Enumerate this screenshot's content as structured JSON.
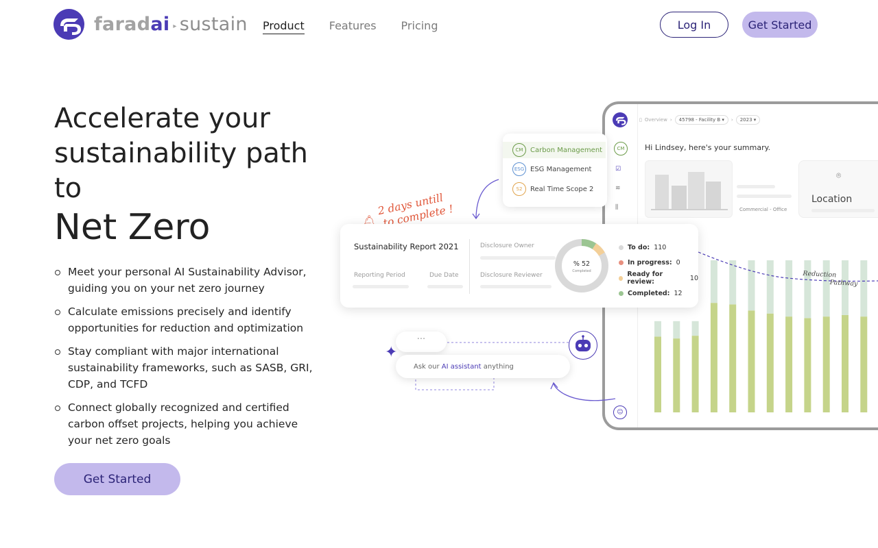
{
  "brand": {
    "name_part1": "farad",
    "name_part2": "ai",
    "separator": "▸",
    "product": "sustain",
    "accent": "#4b3bb5",
    "button_fill": "#c3b9ec"
  },
  "nav": {
    "links": [
      {
        "label": "Product",
        "active": true
      },
      {
        "label": "Features",
        "active": false
      },
      {
        "label": "Pricing",
        "active": false
      }
    ],
    "login_label": "Log In",
    "get_started_label": "Get Started"
  },
  "hero": {
    "title": "Accelerate your sustainability path to",
    "title_emphasis": "Net Zero",
    "bullets": [
      "Meet your personal AI Sustainability Advisor, guiding you on your net zero journey",
      "Calculate emissions precisely and identify opportunities for reduction and optimization",
      "Stay compliant with major international sustainability frameworks, such as SASB, GRI, CDP, and TCFD",
      "Connect globally recognized and certified carbon offset projects, helping you achieve your net zero goals"
    ],
    "cta_label": "Get Started"
  },
  "illustration": {
    "breadcrumb": {
      "root": "Overview",
      "facility": "45798 - Facility B",
      "year": "2023"
    },
    "greeting": "Hi Lindsey, here's your summary.",
    "location_label": "Location",
    "building_type": "Commercial - Office",
    "sidebar_badge": "CM",
    "menu": [
      {
        "badge": "CM",
        "label": "Carbon Management",
        "color": "#6a9a47"
      },
      {
        "badge": "ESG",
        "label": "ESG Management",
        "color": "#5b8fd1"
      },
      {
        "badge": "S2",
        "label": "Real Time Scope 2",
        "color": "#e0a34a"
      }
    ],
    "reminder": {
      "line1": "2 days untill",
      "line2": "to complete !"
    },
    "report": {
      "title": "Sustainability Report 2021",
      "reporting_period_label": "Reporting Period",
      "due_date_label": "Due Date",
      "disclosure_owner_label": "Disclosure Owner",
      "disclosure_reviewer_label": "Disclosure Reviewer",
      "donut_value": "% 52",
      "donut_caption": "Completed",
      "status": [
        {
          "label": "To do:",
          "value": "110",
          "color": "#d9d9d9"
        },
        {
          "label": "In progress:",
          "value": "0",
          "color": "#e8907f"
        },
        {
          "label": "Ready for review:",
          "value": "10",
          "color": "#f3cf98"
        },
        {
          "label": "Completed:",
          "value": "12",
          "color": "#9bc592"
        }
      ]
    },
    "reduction_label_1": "Reduction",
    "reduction_label_2": "Pathway",
    "ai": {
      "dots": "···",
      "ask_prefix": "Ask our ",
      "ask_highlight": "AI assistant",
      "ask_suffix": " anything"
    }
  },
  "chart_data": {
    "type": "bar",
    "stacked": true,
    "bars": 12,
    "series": [
      {
        "values": [
          0.83,
          0.81,
          0.84,
          0.72,
          0.71,
          0.67,
          0.65,
          0.63,
          0.62,
          0.63,
          0.64,
          0.63
        ],
        "color": "#c5d48a"
      },
      {
        "values": [
          0.17,
          0.19,
          0.16,
          0.28,
          0.29,
          0.33,
          0.35,
          0.37,
          0.38,
          0.37,
          0.36,
          0.37
        ],
        "color": "#d6e6d9"
      }
    ]
  }
}
